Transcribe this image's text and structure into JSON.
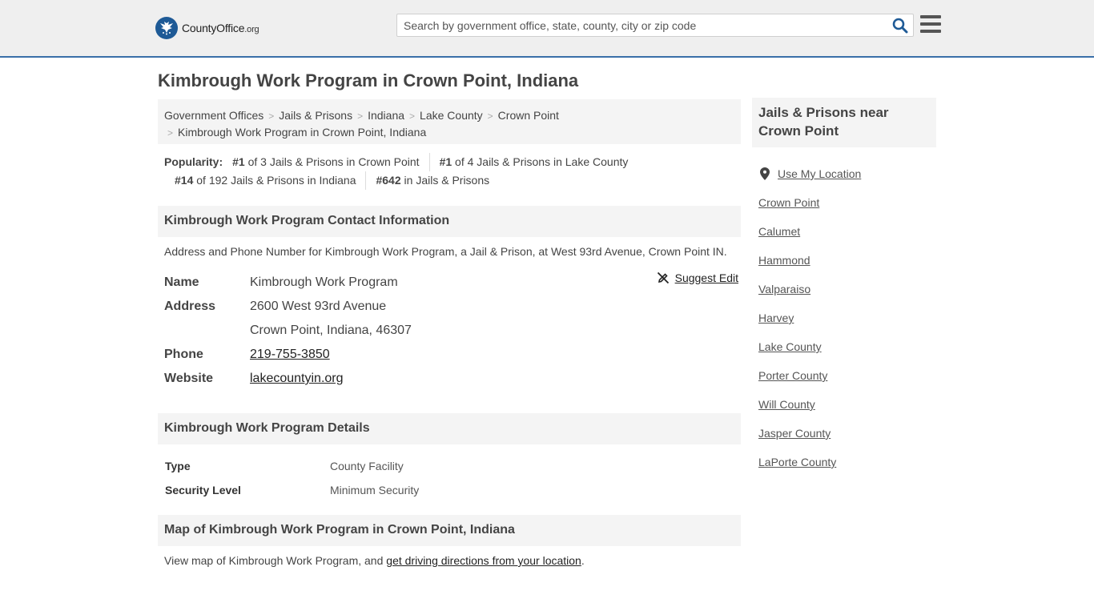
{
  "header": {
    "logo_name": "County",
    "logo_bold": "Office",
    "logo_suffix": ".org",
    "search_placeholder": "Search by government office, state, county, city or zip code"
  },
  "page_title": "Kimbrough Work Program in Crown Point, Indiana",
  "breadcrumb": [
    "Government Offices",
    "Jails & Prisons",
    "Indiana",
    "Lake County",
    "Crown Point",
    "Kimbrough Work Program in Crown Point, Indiana"
  ],
  "popularity": {
    "label": "Popularity:",
    "items": [
      {
        "rank": "#1",
        "text": " of 3 Jails & Prisons in Crown Point"
      },
      {
        "rank": "#1",
        "text": " of 4 Jails & Prisons in Lake County"
      },
      {
        "rank": "#14",
        "text": " of 192 Jails & Prisons in Indiana"
      },
      {
        "rank": "#642",
        "text": " in Jails & Prisons"
      }
    ]
  },
  "contact": {
    "heading": "Kimbrough Work Program Contact Information",
    "description": "Address and Phone Number for Kimbrough Work Program, a Jail & Prison, at West 93rd Avenue, Crown Point IN.",
    "suggest_edit": "Suggest Edit",
    "name_label": "Name",
    "name": "Kimbrough Work Program",
    "address_label": "Address",
    "address_line1": "2600 West 93rd Avenue",
    "address_line2": "Crown Point, Indiana, 46307",
    "phone_label": "Phone",
    "phone": "219-755-3850",
    "website_label": "Website",
    "website": "lakecountyin.org"
  },
  "details": {
    "heading": "Kimbrough Work Program Details",
    "rows": [
      {
        "label": "Type",
        "value": "County Facility"
      },
      {
        "label": "Security Level",
        "value": "Minimum Security"
      }
    ]
  },
  "map": {
    "heading": "Map of Kimbrough Work Program in Crown Point, Indiana",
    "text": "View map of Kimbrough Work Program, and ",
    "link": "get driving directions from your location",
    "end": "."
  },
  "sidebar": {
    "heading": "Jails & Prisons near Crown Point",
    "use_location": "Use My Location",
    "links": [
      "Crown Point",
      "Calumet",
      "Hammond",
      "Valparaiso",
      "Harvey",
      "Lake County",
      "Porter County",
      "Will County",
      "Jasper County",
      "LaPorte County"
    ]
  }
}
